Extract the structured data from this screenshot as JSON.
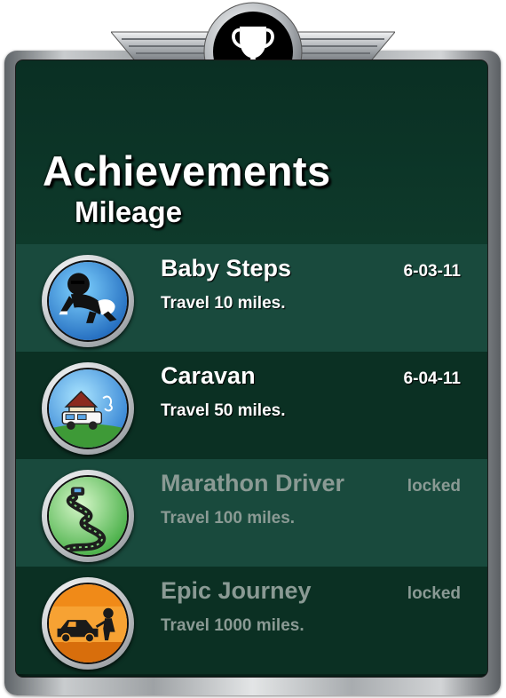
{
  "header": {
    "title": "Achievements",
    "subtitle": "Mileage",
    "emblem_icon": "trophy-icon"
  },
  "achievements": [
    {
      "title": "Baby Steps",
      "description": "Travel 10 miles.",
      "status": "6-03-11",
      "locked": false,
      "icon": "crawling-baby-icon"
    },
    {
      "title": "Caravan",
      "description": "Travel 50 miles.",
      "status": "6-04-11",
      "locked": false,
      "icon": "caravan-icon"
    },
    {
      "title": "Marathon Driver",
      "description": "Travel 100 miles.",
      "status": "locked",
      "locked": true,
      "icon": "winding-road-icon"
    },
    {
      "title": "Epic Journey",
      "description": "Travel 1000 miles.",
      "status": "locked",
      "locked": true,
      "icon": "broken-down-car-icon"
    }
  ],
  "colors": {
    "panel": "#0c3326",
    "row_light": "#194a3d",
    "row_dark": "#0b3023",
    "locked_text": "#8a9a94"
  }
}
